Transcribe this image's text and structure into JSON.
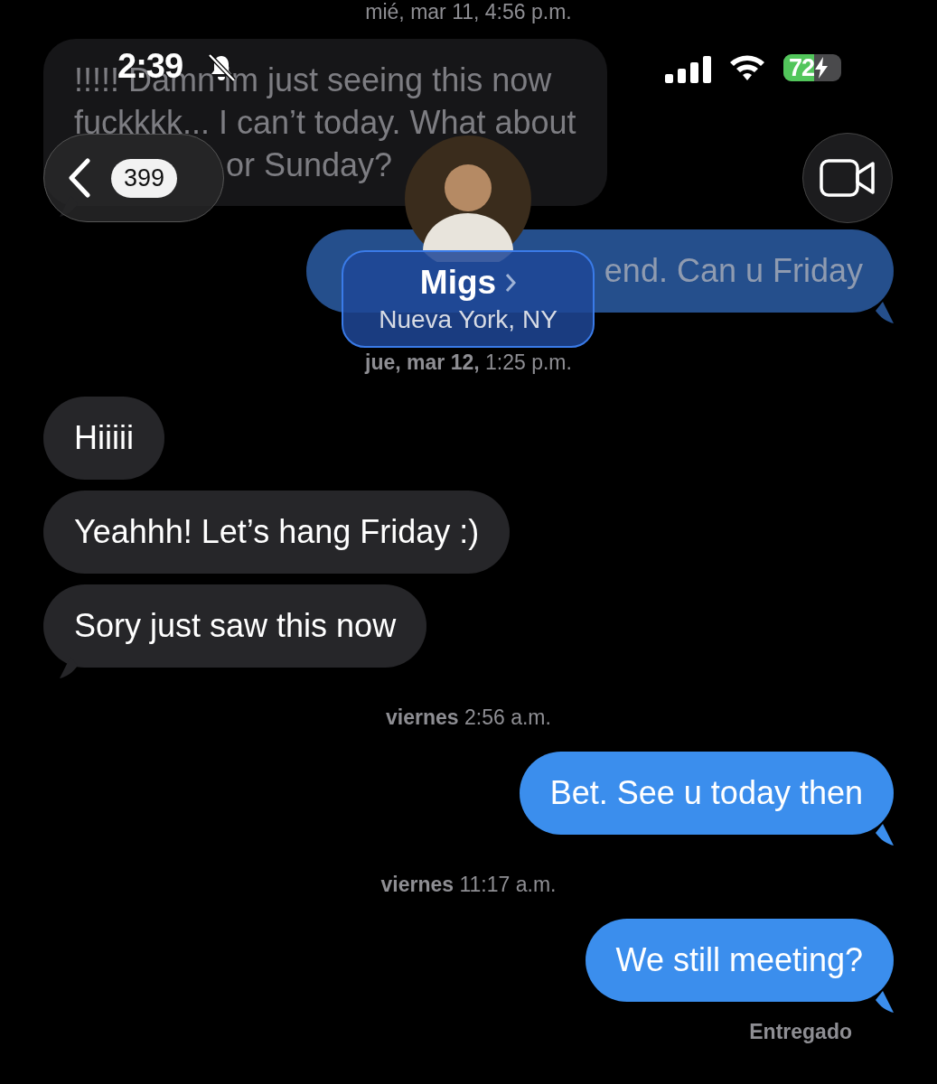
{
  "status_bar": {
    "time": "2:39",
    "battery": "72"
  },
  "header": {
    "back_count": "399",
    "contact": {
      "name": "Migs",
      "location": "Nueva York, NY"
    }
  },
  "messages": [
    {
      "kind": "timestamp",
      "text": "mié, mar 11, 4:56 p.m."
    },
    {
      "kind": "incoming",
      "covered": true,
      "tail": true,
      "lines": [
        "!!!!! Damn im just seeing this now",
        "fuckkkk... I can’t today. What about",
        "or Sunday?"
      ]
    },
    {
      "kind": "outgoing",
      "covered": true,
      "tail": true,
      "lines": [
        "end. Can u Friday"
      ]
    },
    {
      "kind": "timestamp",
      "text": "**jue, mar 12,** 1:25 p.m."
    },
    {
      "kind": "incoming",
      "covered": false,
      "tail": false,
      "lines": [
        "Hiiiii"
      ]
    },
    {
      "kind": "incoming",
      "covered": false,
      "tail": false,
      "lines": [
        "Yeahhh! Let’s hang Friday :)"
      ]
    },
    {
      "kind": "incoming",
      "covered": false,
      "tail": true,
      "lines": [
        "Sory just saw this now"
      ]
    },
    {
      "kind": "timestamp",
      "text": "**viernes** 2:56 a.m."
    },
    {
      "kind": "outgoing",
      "covered": false,
      "tail": true,
      "lines": [
        "Bet. See u today then"
      ]
    },
    {
      "kind": "timestamp",
      "text": "**viernes** 11:17 a.m."
    },
    {
      "kind": "outgoing",
      "covered": false,
      "tail": true,
      "lines": [
        "We still meeting?"
      ]
    },
    {
      "kind": "status",
      "text": "Entregado"
    }
  ]
}
